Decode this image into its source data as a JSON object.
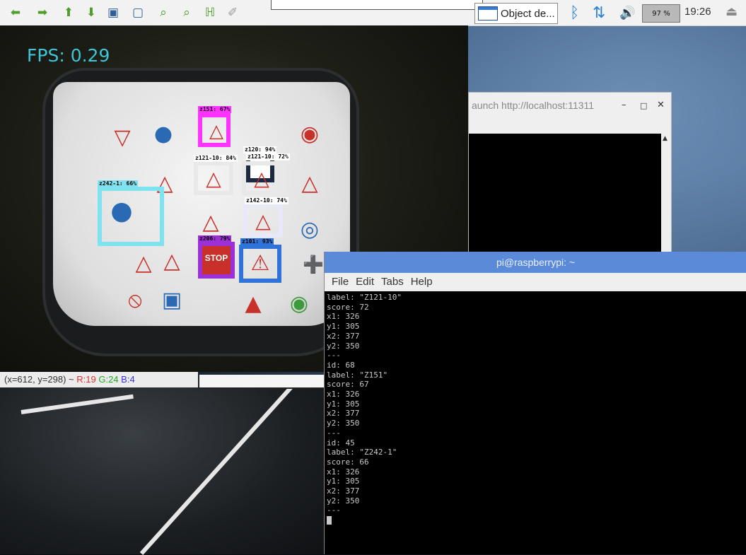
{
  "panel": {
    "toolbar": [
      "arrow-left-icon",
      "arrow-right-icon",
      "arrow-up-icon",
      "arrow-down-icon",
      "image-icon",
      "fit-icon",
      "zoom-in-icon",
      "zoom-out-icon",
      "save-icon",
      "brush-icon"
    ],
    "task_label": "Object de...",
    "battery": "97 %",
    "clock": "19:26"
  },
  "camera": {
    "fps": "FPS: 0.29",
    "detections": [
      {
        "label": "z151: 67%",
        "color": "#ff33ff"
      },
      {
        "label": "z120: 94%",
        "color": "#ffffff"
      },
      {
        "label": "z121-10: 84%",
        "color": "#ffffff"
      },
      {
        "label": "z121-10: 72%",
        "color": "#ffffff"
      },
      {
        "label": "z242-1: 66%",
        "color": "#7fe3ef"
      },
      {
        "label": "z142-10: 74%",
        "color": "#ffffff"
      },
      {
        "label": "z206: 79%",
        "color": "#9b30d6"
      },
      {
        "label": "z101: 93%",
        "color": "#2f73d8"
      }
    ],
    "status": {
      "prefix": "(x=612, y=298) ~ ",
      "r": "R:19",
      "g": "G:24",
      "b": "B:4"
    },
    "stop_text": "STOP"
  },
  "ros_window": {
    "title": "aunch http://localhost:11311",
    "minimize": "–",
    "maximize": "□",
    "close": "✕"
  },
  "terminal": {
    "title": "pi@raspberrypi: ~",
    "menu": [
      "File",
      "Edit",
      "Tabs",
      "Help"
    ],
    "lines": [
      "label: \"Z121-10\"",
      "score: 72",
      "x1: 326",
      "y1: 305",
      "x2: 377",
      "y2: 350",
      "---",
      "id: 68",
      "label: \"Z151\"",
      "score: 67",
      "x1: 326",
      "y1: 305",
      "x2: 377",
      "y2: 350",
      "---",
      "id: 45",
      "label: \"Z242-1\"",
      "score: 66",
      "x1: 326",
      "y1: 305",
      "x2: 377",
      "y2: 350",
      "---"
    ]
  }
}
